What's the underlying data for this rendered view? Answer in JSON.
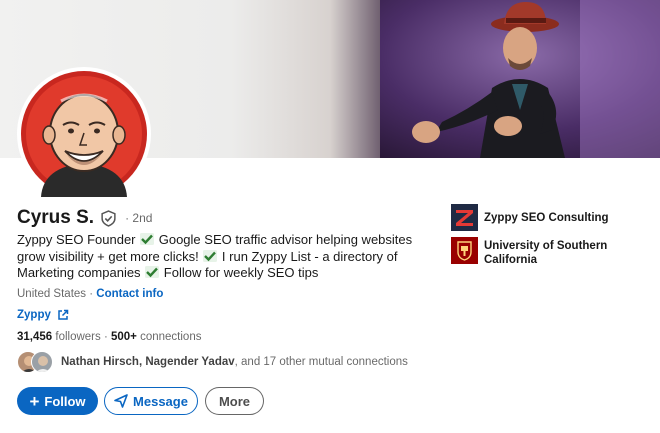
{
  "profile": {
    "name": "Cyrus S.",
    "degree": "· 2nd",
    "headline_parts": [
      "Zyppy SEO Founder ",
      " Google SEO traffic advisor helping websites grow visibility + get more clicks! ",
      " I run Zyppy List - a directory of Marketing companies ",
      " Follow for weekly SEO tips"
    ],
    "location": "United States",
    "location_sep": " · ",
    "contact_label": "Contact info",
    "website_label": "Zyppy",
    "followers_count": "31,456",
    "followers_label": " followers",
    "connections_sep": " · ",
    "connections_count": "500+",
    "connections_label": " connections",
    "mutual_names": "Nathan Hirsch, Nagender Yadav",
    "mutual_suffix": ", and 17 other mutual connections"
  },
  "actions": {
    "follow_label": "Follow",
    "message_label": "Message",
    "more_label": "More"
  },
  "organizations": [
    {
      "name": "Zyppy SEO Consulting",
      "icon": "zyppy-logo"
    },
    {
      "name": "University of Southern California",
      "icon": "usc-seal-logo"
    }
  ],
  "colors": {
    "brand_blue": "#0a66c2",
    "check_green": "#2e7d32",
    "zyppy_red": "#d32f2f",
    "usc_cardinal": "#990000"
  }
}
